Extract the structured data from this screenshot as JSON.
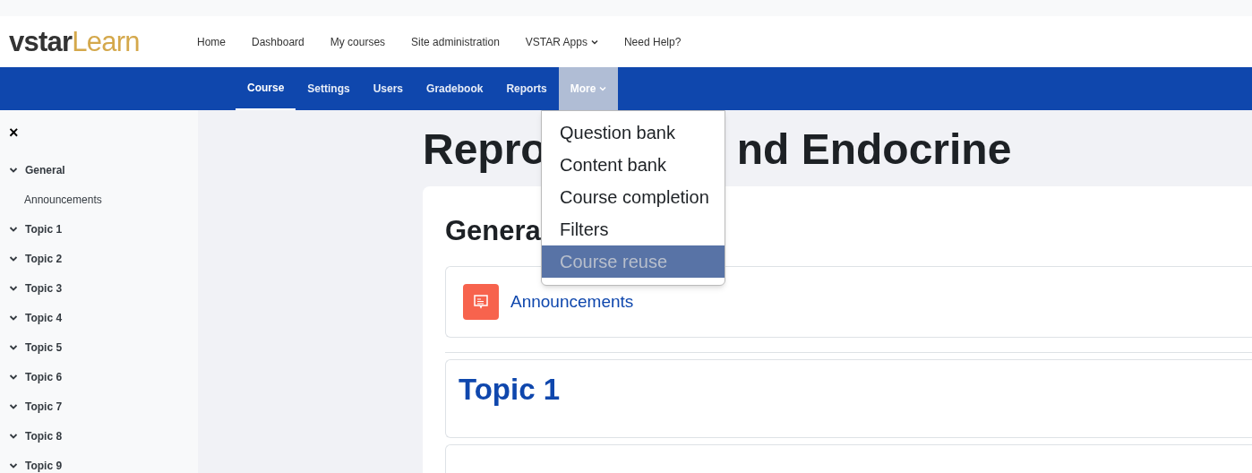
{
  "logo": {
    "part_1": "vstar",
    "part_2": "Learn"
  },
  "top_nav": [
    {
      "label": "Home",
      "has_menu": false
    },
    {
      "label": "Dashboard",
      "has_menu": false
    },
    {
      "label": "My courses",
      "has_menu": false
    },
    {
      "label": "Site administration",
      "has_menu": false
    },
    {
      "label": "VSTAR Apps",
      "has_menu": true
    },
    {
      "label": "Need Help?",
      "has_menu": false
    }
  ],
  "course_nav": [
    {
      "label": "Course",
      "selected": true,
      "has_menu": false
    },
    {
      "label": "Settings",
      "selected": false,
      "has_menu": false
    },
    {
      "label": "Users",
      "selected": false,
      "has_menu": false
    },
    {
      "label": "Gradebook",
      "selected": false,
      "has_menu": false
    },
    {
      "label": "Reports",
      "selected": false,
      "has_menu": false
    },
    {
      "label": "More",
      "selected": false,
      "has_menu": true,
      "expanded": true
    }
  ],
  "more_menu": [
    {
      "label": "Question bank",
      "selected": false
    },
    {
      "label": "Content bank",
      "selected": false
    },
    {
      "label": "Course completion",
      "selected": false
    },
    {
      "label": "Filters",
      "selected": false
    },
    {
      "label": "Course reuse",
      "selected": true
    }
  ],
  "sidebar": {
    "close": "×",
    "sections": [
      {
        "label": "General",
        "expanded": true,
        "children": [
          {
            "label": "Announcements"
          }
        ]
      },
      {
        "label": "Topic 1",
        "expanded": true
      },
      {
        "label": "Topic 2",
        "expanded": true
      },
      {
        "label": "Topic 3",
        "expanded": true
      },
      {
        "label": "Topic 4",
        "expanded": true
      },
      {
        "label": "Topic 5",
        "expanded": true
      },
      {
        "label": "Topic 6",
        "expanded": true
      },
      {
        "label": "Topic 7",
        "expanded": true
      },
      {
        "label": "Topic 8",
        "expanded": true
      },
      {
        "label": "Topic 9",
        "expanded": true
      }
    ]
  },
  "page_title": {
    "visible_start": "Repro",
    "visible_end": "nd Endocrine"
  },
  "section_heading": "Genera",
  "activity": {
    "label": "Announcements"
  },
  "topic_heading": "Topic 1"
}
